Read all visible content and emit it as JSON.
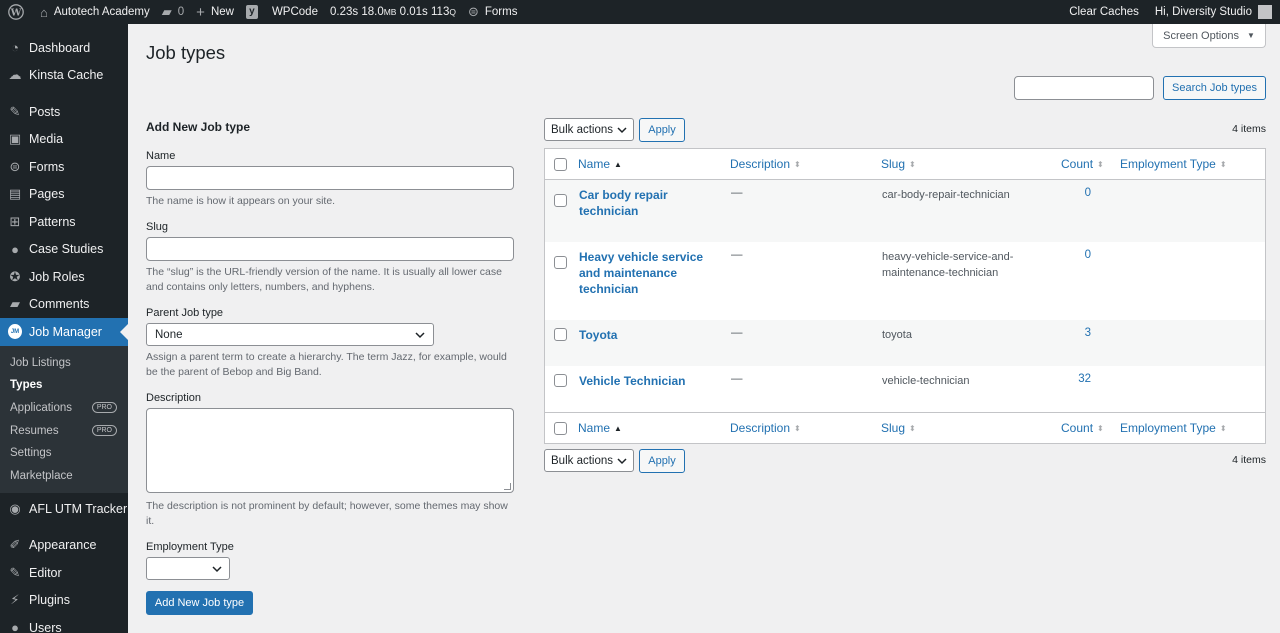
{
  "admin_bar": {
    "site_name": "Autotech Academy",
    "comments_count": "0",
    "new_label": "New",
    "wpcode_label": "WPCode",
    "perf_time": "0.23s",
    "perf_mem": "18.0",
    "perf_mem_unit": "MB",
    "perf_query_time": "0.01s",
    "perf_queries": "113",
    "perf_queries_unit": "Q",
    "forms_label": "Forms",
    "clear_caches": "Clear Caches",
    "greeting": "Hi, Diversity Studio"
  },
  "sidebar": {
    "items": [
      {
        "label": "Dashboard",
        "icon": "dashboard-icon"
      },
      {
        "label": "Kinsta Cache",
        "icon": "cloud-icon"
      },
      {
        "label": "Posts",
        "icon": "pin-icon"
      },
      {
        "label": "Media",
        "icon": "media-icon"
      },
      {
        "label": "Forms",
        "icon": "forms-icon"
      },
      {
        "label": "Pages",
        "icon": "pages-icon"
      },
      {
        "label": "Patterns",
        "icon": "patterns-icon"
      },
      {
        "label": "Case Studies",
        "icon": "person-icon"
      },
      {
        "label": "Job Roles",
        "icon": "accessibility-icon"
      },
      {
        "label": "Comments",
        "icon": "comment-icon"
      },
      {
        "label": "Job Manager",
        "icon": "job-manager-icon",
        "badge_text": "JM"
      }
    ],
    "submenu": [
      {
        "label": "Job Listings"
      },
      {
        "label": "Types"
      },
      {
        "label": "Applications",
        "badge": "PRO"
      },
      {
        "label": "Resumes",
        "badge": "PRO"
      },
      {
        "label": "Settings"
      },
      {
        "label": "Marketplace"
      }
    ],
    "after_items": [
      {
        "label": "AFL UTM Tracker",
        "icon": "tracker-icon"
      },
      {
        "label": "Appearance",
        "icon": "brush-icon"
      },
      {
        "label": "Editor",
        "icon": "editor-icon"
      },
      {
        "label": "Plugins",
        "icon": "plugin-icon"
      },
      {
        "label": "Users",
        "icon": "users-icon"
      }
    ]
  },
  "page": {
    "title": "Job types",
    "screen_options": "Screen Options",
    "search_button": "Search Job types",
    "search_value": ""
  },
  "form": {
    "heading": "Add New Job type",
    "name_label": "Name",
    "name_help": "The name is how it appears on your site.",
    "slug_label": "Slug",
    "slug_help": "The “slug” is the URL-friendly version of the name. It is usually all lower case and contains only letters, numbers, and hyphens.",
    "parent_label": "Parent Job type",
    "parent_value": "None",
    "parent_help": "Assign a parent term to create a hierarchy. The term Jazz, for example, would be the parent of Bebop and Big Band.",
    "description_label": "Description",
    "description_help": "The description is not prominent by default; however, some themes may show it.",
    "employment_label": "Employment Type",
    "employment_value": "",
    "submit": "Add New Job type"
  },
  "table": {
    "bulk_actions": "Bulk actions",
    "apply": "Apply",
    "items_count": "4 items",
    "columns": {
      "name": "Name",
      "description": "Description",
      "slug": "Slug",
      "count": "Count",
      "employment_type": "Employment Type"
    },
    "rows": [
      {
        "name_line1": "Car body repair",
        "name_line2": "technician",
        "name_line3": "",
        "description": "—",
        "slug_line1": "car-body-repair-technician",
        "slug_line2": "",
        "count": "0"
      },
      {
        "name_line1": "Heavy vehicle service",
        "name_line2": "and maintenance",
        "name_line3": "technician",
        "description": "—",
        "slug_line1": "heavy-vehicle-service-and-",
        "slug_line2": "maintenance-technician",
        "count": "0"
      },
      {
        "name_line1": "Toyota",
        "name_line2": "",
        "name_line3": "",
        "description": "—",
        "slug_line1": "toyota",
        "slug_line2": "",
        "count": "3"
      },
      {
        "name_line1": "Vehicle Technician",
        "name_line2": "",
        "name_line3": "",
        "description": "—",
        "slug_line1": "vehicle-technician",
        "slug_line2": "",
        "count": "32"
      }
    ]
  }
}
